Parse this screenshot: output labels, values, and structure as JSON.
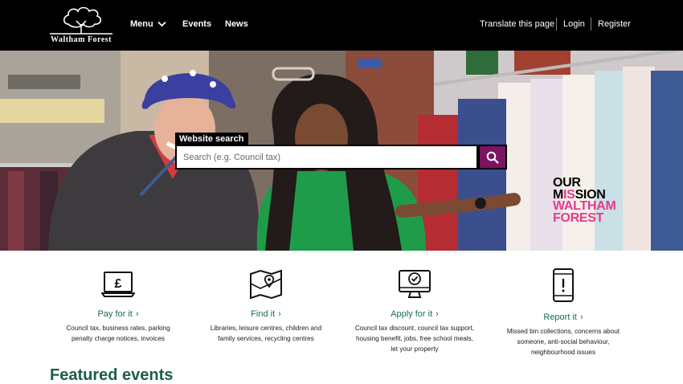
{
  "header": {
    "logo_text": "Waltham Forest",
    "nav": {
      "menu": "Menu",
      "events": "Events",
      "news": "News"
    },
    "util": {
      "translate": "Translate this page",
      "login": "Login",
      "register": "Register"
    }
  },
  "hero": {
    "search_label": "Website search",
    "search_placeholder": "Search (e.g. Council tax)",
    "mission": {
      "line1": "OUR",
      "line2_a": "M",
      "line2_b": "IS",
      "line2_c": "SION",
      "line3": "WALTHAM",
      "line4": "FOREST"
    }
  },
  "services": [
    {
      "icon": "pound-laptop-icon",
      "title": "Pay for it",
      "desc": "Council tax, business rates, parking penalty charge notices, invoices"
    },
    {
      "icon": "map-pin-icon",
      "title": "Find it",
      "desc": "Libraries, leisure centres, children and family services, recycling centres"
    },
    {
      "icon": "monitor-check-icon",
      "title": "Apply for it",
      "desc": "Council tax discount, council tax support, housing benefit, jobs, free school meals, let your property"
    },
    {
      "icon": "phone-alert-icon",
      "title": "Report it",
      "desc": "Missed bin collections, concerns about someone, anti-social behaviour, neighbourhood issues"
    }
  ],
  "featured_title": "Featured events",
  "colors": {
    "header_bg": "#000000",
    "search_button": "#7a1463",
    "mission_pink": "#e6398f",
    "link_green": "#1a6b5a",
    "heading_green": "#1d5c4b"
  }
}
